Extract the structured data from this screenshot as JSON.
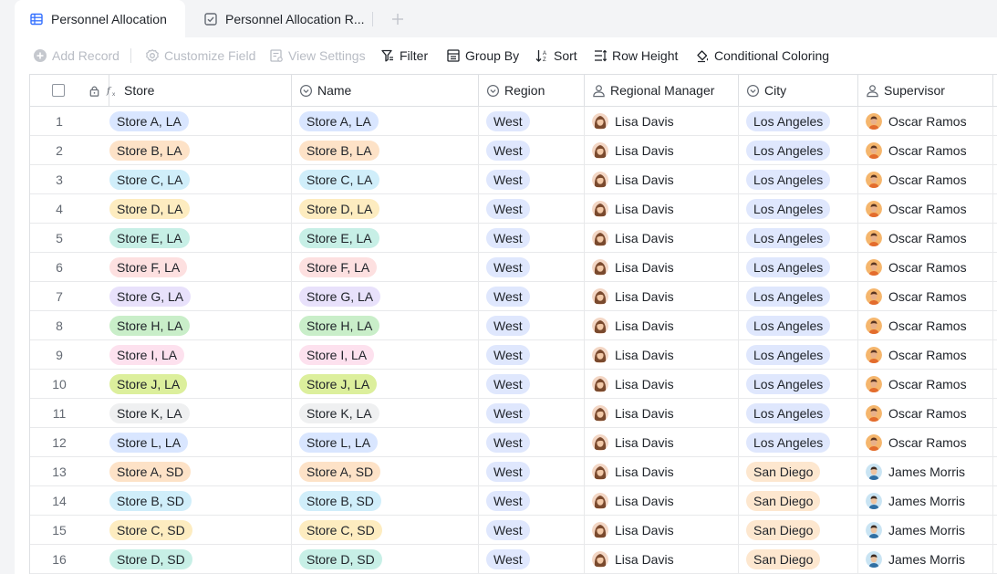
{
  "tabs": [
    {
      "label": "Personnel Allocation",
      "icon": "grid-table-icon"
    },
    {
      "label": "Personnel Allocation R...",
      "icon": "checkbox-table-icon"
    }
  ],
  "toolbar": {
    "add_record": "Add Record",
    "customize_field": "Customize Field",
    "view_settings": "View Settings",
    "filter": "Filter",
    "group_by": "Group By",
    "sort": "Sort",
    "row_height": "Row Height",
    "conditional_coloring": "Conditional Coloring"
  },
  "columns": {
    "store": "Store",
    "name": "Name",
    "region": "Region",
    "regional_manager": "Regional Manager",
    "city": "City",
    "supervisor": "Supervisor"
  },
  "colors": {
    "accent": "#3370ff",
    "tag_colors": [
      "#d9e6ff",
      "#fde2c7",
      "#d0eefa",
      "#fdecc0",
      "#c7efe6",
      "#fde0e0",
      "#e8e1fb",
      "#c9eec9",
      "#fde1ee",
      "#dcef9c",
      "#eff0f1",
      "#d9e6ff"
    ],
    "region_tag": "#dfe7fd",
    "city_la_tag": "#dfe7fd",
    "city_sd_tag": "#fde7cf"
  },
  "rows": [
    {
      "num": "1",
      "store": "Store A, LA",
      "name": "Store A, LA",
      "region": "West",
      "regional_manager": "Lisa Davis",
      "city": "Los Angeles",
      "supervisor": "Oscar Ramos",
      "tag": 0
    },
    {
      "num": "2",
      "store": "Store B, LA",
      "name": "Store B, LA",
      "region": "West",
      "regional_manager": "Lisa Davis",
      "city": "Los Angeles",
      "supervisor": "Oscar Ramos",
      "tag": 1
    },
    {
      "num": "3",
      "store": "Store C, LA",
      "name": "Store C, LA",
      "region": "West",
      "regional_manager": "Lisa Davis",
      "city": "Los Angeles",
      "supervisor": "Oscar Ramos",
      "tag": 2
    },
    {
      "num": "4",
      "store": "Store D, LA",
      "name": "Store D, LA",
      "region": "West",
      "regional_manager": "Lisa Davis",
      "city": "Los Angeles",
      "supervisor": "Oscar Ramos",
      "tag": 3
    },
    {
      "num": "5",
      "store": "Store E, LA",
      "name": "Store E, LA",
      "region": "West",
      "regional_manager": "Lisa Davis",
      "city": "Los Angeles",
      "supervisor": "Oscar Ramos",
      "tag": 4
    },
    {
      "num": "6",
      "store": "Store F, LA",
      "name": "Store F, LA",
      "region": "West",
      "regional_manager": "Lisa Davis",
      "city": "Los Angeles",
      "supervisor": "Oscar Ramos",
      "tag": 5
    },
    {
      "num": "7",
      "store": "Store G, LA",
      "name": "Store G, LA",
      "region": "West",
      "regional_manager": "Lisa Davis",
      "city": "Los Angeles",
      "supervisor": "Oscar Ramos",
      "tag": 6
    },
    {
      "num": "8",
      "store": "Store H, LA",
      "name": "Store H, LA",
      "region": "West",
      "regional_manager": "Lisa Davis",
      "city": "Los Angeles",
      "supervisor": "Oscar Ramos",
      "tag": 7
    },
    {
      "num": "9",
      "store": "Store I, LA",
      "name": "Store I, LA",
      "region": "West",
      "regional_manager": "Lisa Davis",
      "city": "Los Angeles",
      "supervisor": "Oscar Ramos",
      "tag": 8
    },
    {
      "num": "10",
      "store": "Store J, LA",
      "name": "Store J, LA",
      "region": "West",
      "regional_manager": "Lisa Davis",
      "city": "Los Angeles",
      "supervisor": "Oscar Ramos",
      "tag": 9
    },
    {
      "num": "11",
      "store": "Store K, LA",
      "name": "Store K, LA",
      "region": "West",
      "regional_manager": "Lisa Davis",
      "city": "Los Angeles",
      "supervisor": "Oscar Ramos",
      "tag": 10
    },
    {
      "num": "12",
      "store": "Store L, LA",
      "name": "Store L, LA",
      "region": "West",
      "regional_manager": "Lisa Davis",
      "city": "Los Angeles",
      "supervisor": "Oscar Ramos",
      "tag": 11
    },
    {
      "num": "13",
      "store": "Store A, SD",
      "name": "Store A, SD",
      "region": "West",
      "regional_manager": "Lisa Davis",
      "city": "San Diego",
      "supervisor": "James Morris",
      "tag": 1
    },
    {
      "num": "14",
      "store": "Store B, SD",
      "name": "Store B, SD",
      "region": "West",
      "regional_manager": "Lisa Davis",
      "city": "San Diego",
      "supervisor": "James Morris",
      "tag": 2
    },
    {
      "num": "15",
      "store": "Store C, SD",
      "name": "Store C, SD",
      "region": "West",
      "regional_manager": "Lisa Davis",
      "city": "San Diego",
      "supervisor": "James Morris",
      "tag": 3
    },
    {
      "num": "16",
      "store": "Store D, SD",
      "name": "Store D, SD",
      "region": "West",
      "regional_manager": "Lisa Davis",
      "city": "San Diego",
      "supervisor": "James Morris",
      "tag": 4
    }
  ]
}
